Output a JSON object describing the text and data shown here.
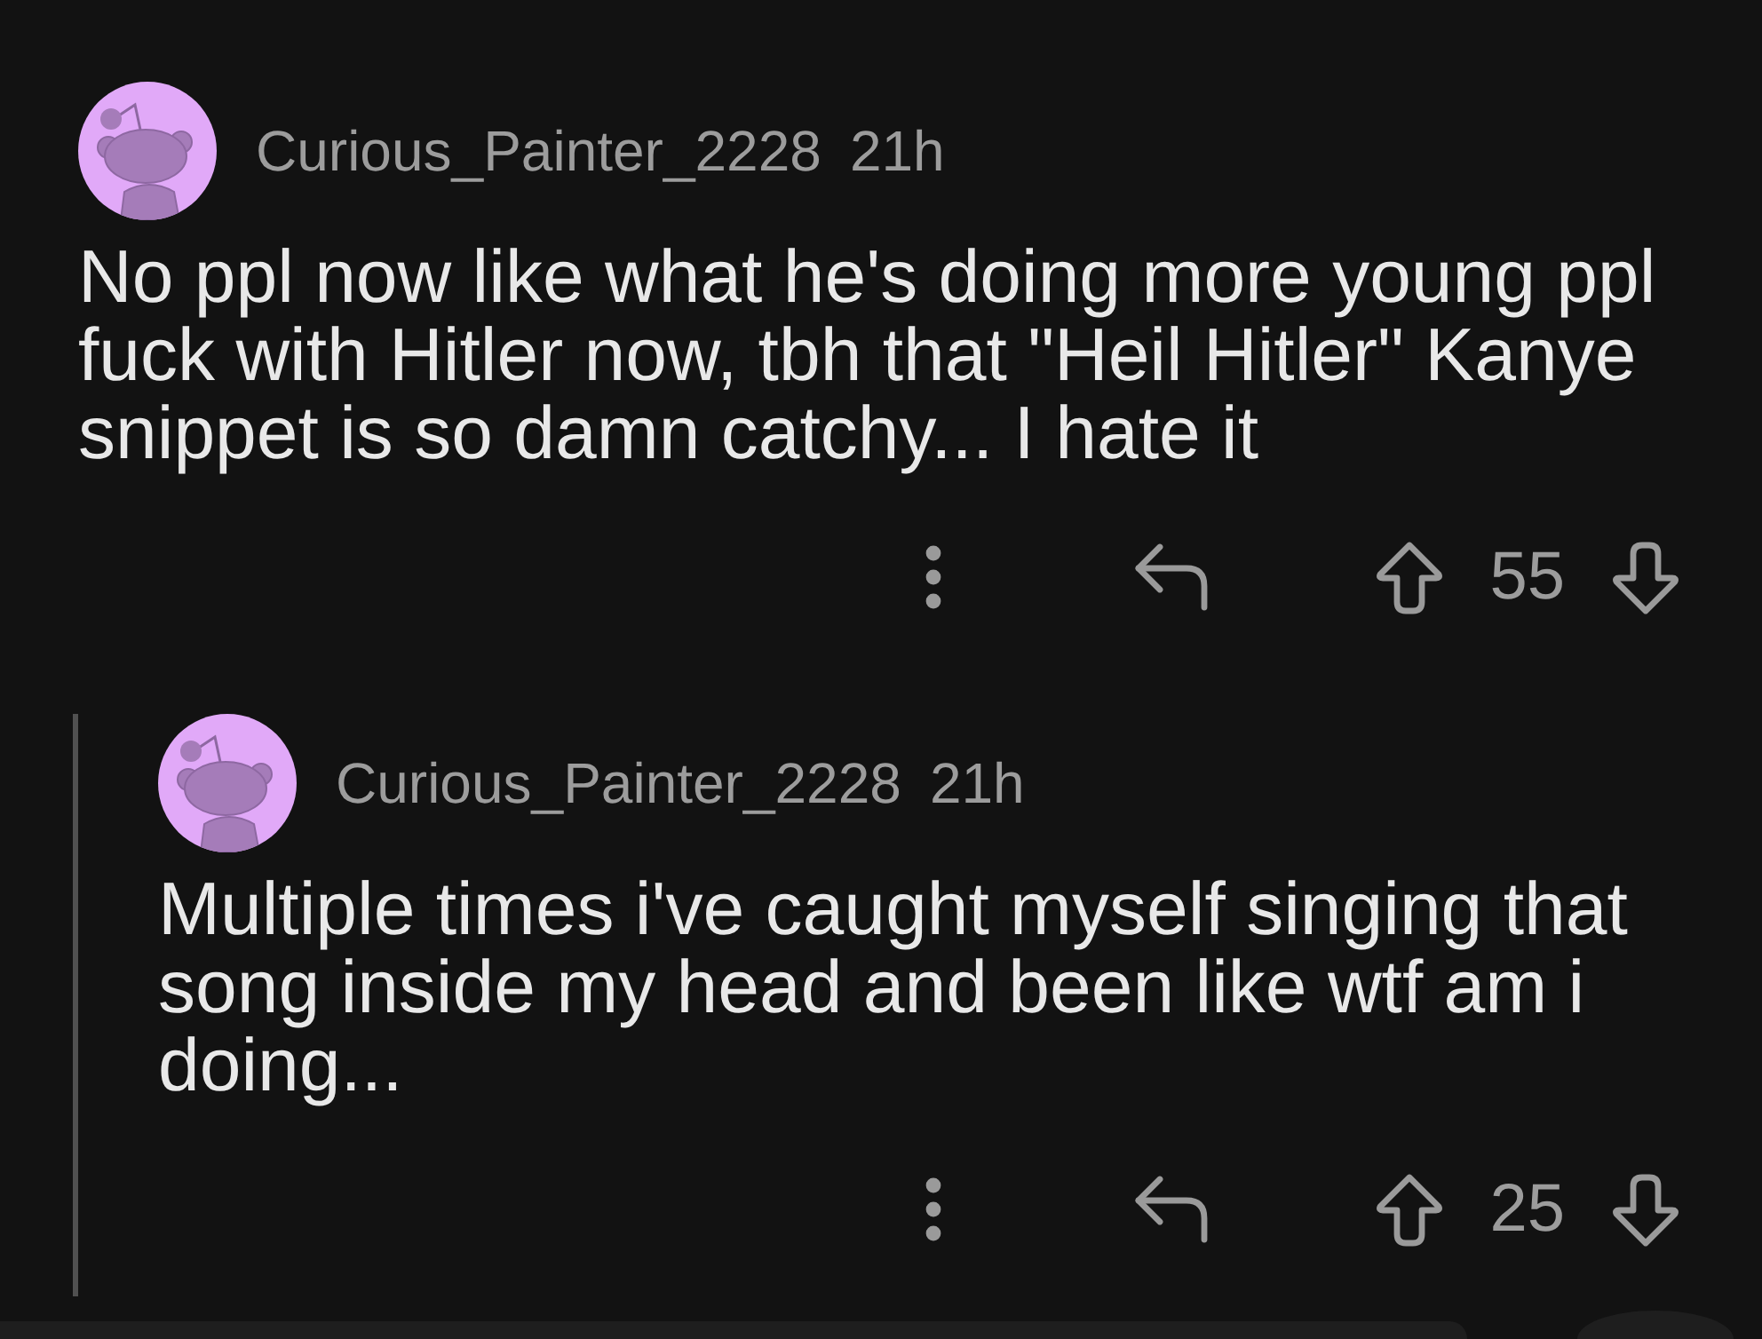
{
  "comments": [
    {
      "author": "Curious_Painter_2228",
      "time": "21h",
      "body": "No ppl now like what he's doing more young ppl fuck with Hitler now, tbh that \"Heil Hitler\" Kanye snippet is so damn catchy... I hate it",
      "score": "55",
      "children": [
        {
          "author": "Curious_Painter_2228",
          "time": "21h",
          "body": "Multiple times i've caught myself singing that song inside my head and been like wtf am i doing...",
          "score": "25"
        }
      ]
    }
  ]
}
